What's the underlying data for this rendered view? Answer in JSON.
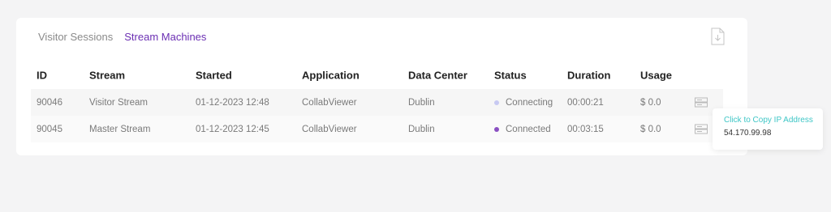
{
  "tabs": [
    {
      "label": "Visitor Sessions"
    },
    {
      "label": "Stream Machines"
    }
  ],
  "colors": {
    "accent": "#6b2fb3",
    "status_connecting": "#c7c9f2",
    "status_connected": "#8a4fc2",
    "tooltip_title": "#3ec6c6"
  },
  "icons": {
    "download": "download-icon",
    "server": "server-icon"
  },
  "table": {
    "headers": {
      "id": "ID",
      "stream": "Stream",
      "started": "Started",
      "application": "Application",
      "data_center": "Data Center",
      "status": "Status",
      "duration": "Duration",
      "usage": "Usage"
    },
    "rows": [
      {
        "id": "90046",
        "stream": "Visitor Stream",
        "started": "01-12-2023 12:48",
        "application": "CollabViewer",
        "data_center": "Dublin",
        "status": "Connecting",
        "duration": "00:00:21",
        "usage": "$ 0.0"
      },
      {
        "id": "90045",
        "stream": "Master Stream",
        "started": "01-12-2023 12:45",
        "application": "CollabViewer",
        "data_center": "Dublin",
        "status": "Connected",
        "duration": "00:03:15",
        "usage": "$ 0.0"
      }
    ]
  },
  "tooltip": {
    "title": "Click to Copy IP Address",
    "ip": "54.170.99.98"
  }
}
